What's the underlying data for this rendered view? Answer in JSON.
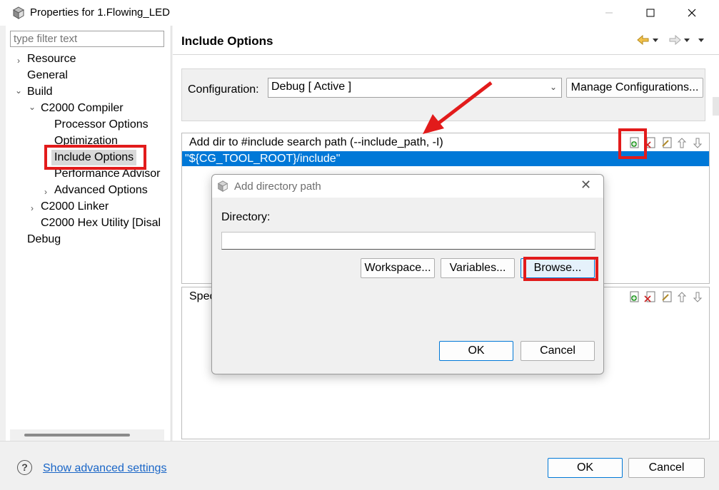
{
  "window": {
    "title": "Properties for 1.Flowing_LED",
    "controls": [
      "minimize",
      "maximize",
      "close"
    ]
  },
  "left": {
    "filter_placeholder": "type filter text",
    "tree": [
      {
        "label": "Resource",
        "expander": "›"
      },
      {
        "label": "General",
        "expander": ""
      },
      {
        "label": "Build",
        "expander": "⌄"
      },
      {
        "label": "C2000 Compiler",
        "expander": "⌄"
      },
      {
        "label": "Processor Options",
        "expander": ""
      },
      {
        "label": "Optimization",
        "expander": ""
      },
      {
        "label": "Include Options",
        "expander": "",
        "selected": true
      },
      {
        "label": "Performance Advisor",
        "expander": ""
      },
      {
        "label": "Advanced Options",
        "expander": "›"
      },
      {
        "label": "C2000 Linker",
        "expander": "›"
      },
      {
        "label": "C2000 Hex Utility  [Disal",
        "expander": ""
      },
      {
        "label": "Debug",
        "expander": ""
      }
    ]
  },
  "right": {
    "title": "Include Options",
    "configuration_label": "Configuration:",
    "configuration_value": "Debug  [ Active ]",
    "manage_button": "Manage Configurations...",
    "include_list": {
      "header": "Add dir to #include search path (--include_path, -I)",
      "rows": [
        "\"${CG_TOOL_ROOT}/include\""
      ]
    },
    "second_list": {
      "header": "Spec"
    }
  },
  "dialog": {
    "title": "Add directory path",
    "directory_label": "Directory:",
    "directory_value": "",
    "workspace_button": "Workspace...",
    "variables_button": "Variables...",
    "browse_button": "Browse...",
    "ok_button": "OK",
    "cancel_button": "Cancel"
  },
  "footer": {
    "help_symbol": "?",
    "advanced_link": "Show advanced settings",
    "ok_button": "OK",
    "cancel_button": "Cancel"
  },
  "annotation_color": "#e21b1b",
  "selection_color": "#0078d7"
}
